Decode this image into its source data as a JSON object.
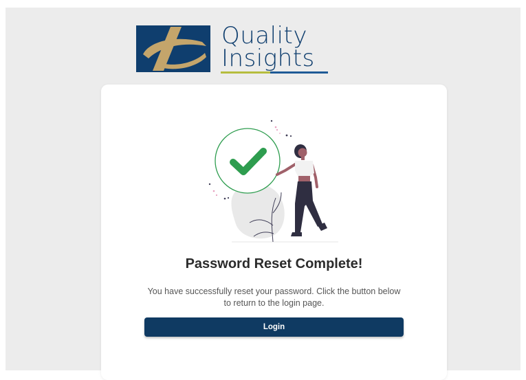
{
  "brand": {
    "logo_line1": "Quality",
    "logo_line2": "Insights",
    "colors": {
      "navy": "#0f3e6e",
      "gold": "#c4a56b",
      "green_rule": "#b5bd3e",
      "blue_rule": "#1e5a96"
    }
  },
  "card": {
    "illustration_icon": "success-checkmark-person-illustration",
    "title": "Password Reset Complete!",
    "message": "You have successfully reset your password. Click the button below to return to the login page.",
    "button_label": "Login",
    "accent_color": "#2e9d4f",
    "button_color": "#0f3a62"
  }
}
